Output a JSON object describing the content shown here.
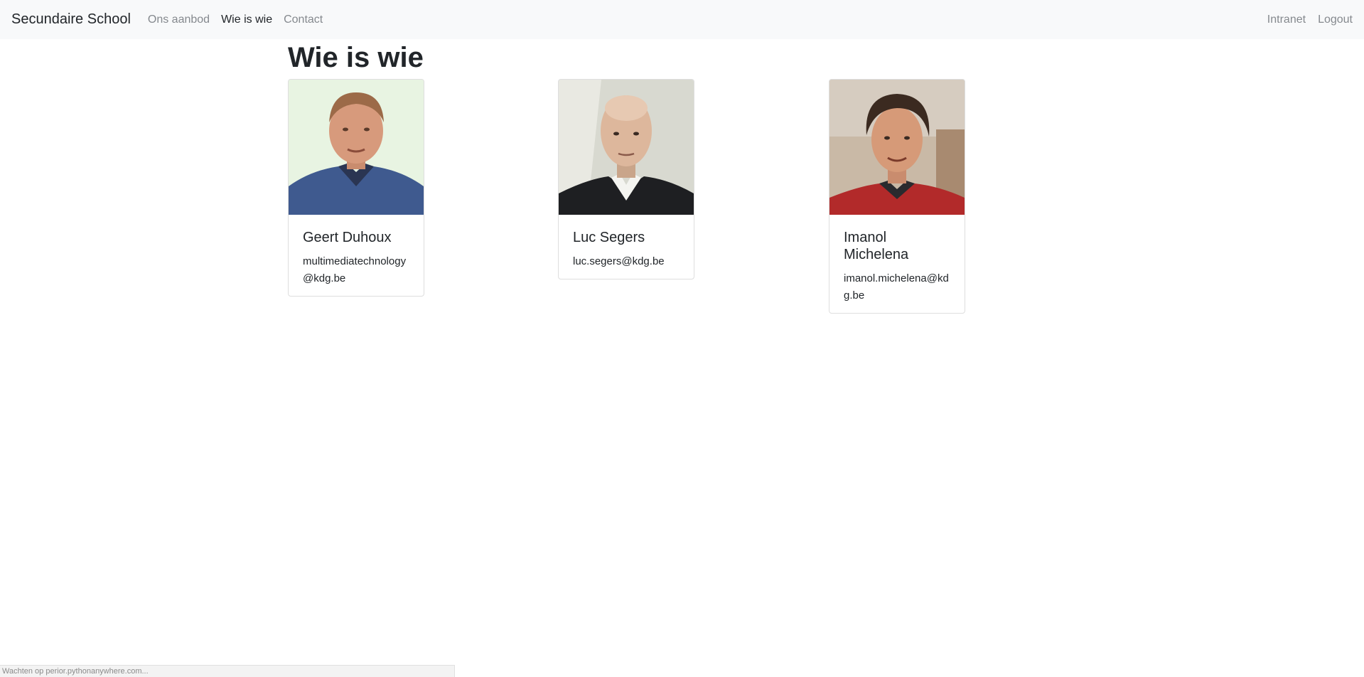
{
  "navbar": {
    "brand": "Secundaire School",
    "links": [
      {
        "label": "Ons aanbod"
      },
      {
        "label": "Wie is wie"
      },
      {
        "label": "Contact"
      }
    ],
    "right_links": [
      {
        "label": "Intranet"
      },
      {
        "label": "Logout"
      }
    ]
  },
  "page": {
    "title": "Wie is wie"
  },
  "people": [
    {
      "name": "Geert Duhoux",
      "email": "multimediatechnology@kdg.be"
    },
    {
      "name": "Luc Segers",
      "email": "luc.segers@kdg.be"
    },
    {
      "name": "Imanol Michelena",
      "email": "imanol.michelena@kdg.be"
    }
  ],
  "status_bar": {
    "text": "Wachten op perior.pythonanywhere.com..."
  }
}
